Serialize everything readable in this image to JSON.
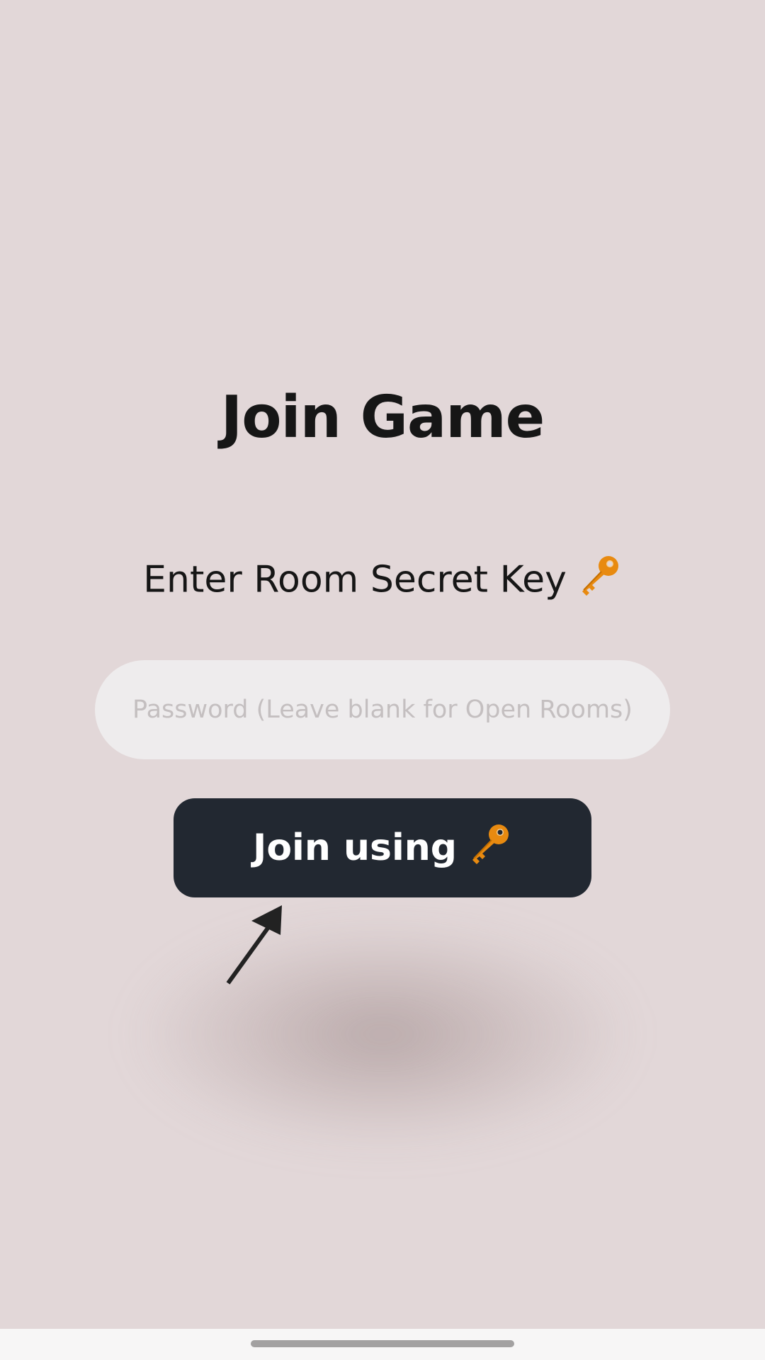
{
  "page": {
    "title": "Join Game",
    "subtitle": "Enter Room Secret Key"
  },
  "password": {
    "placeholder": "Password (Leave blank for Open Rooms)",
    "value": ""
  },
  "join_button": {
    "label": "Join using"
  },
  "icons": {
    "key": "key-icon",
    "arrow": "pointer-arrow-icon"
  },
  "colors": {
    "background": "#e2d7d8",
    "button": "#222831",
    "key": "#e88a10",
    "field": "#eeeced"
  }
}
